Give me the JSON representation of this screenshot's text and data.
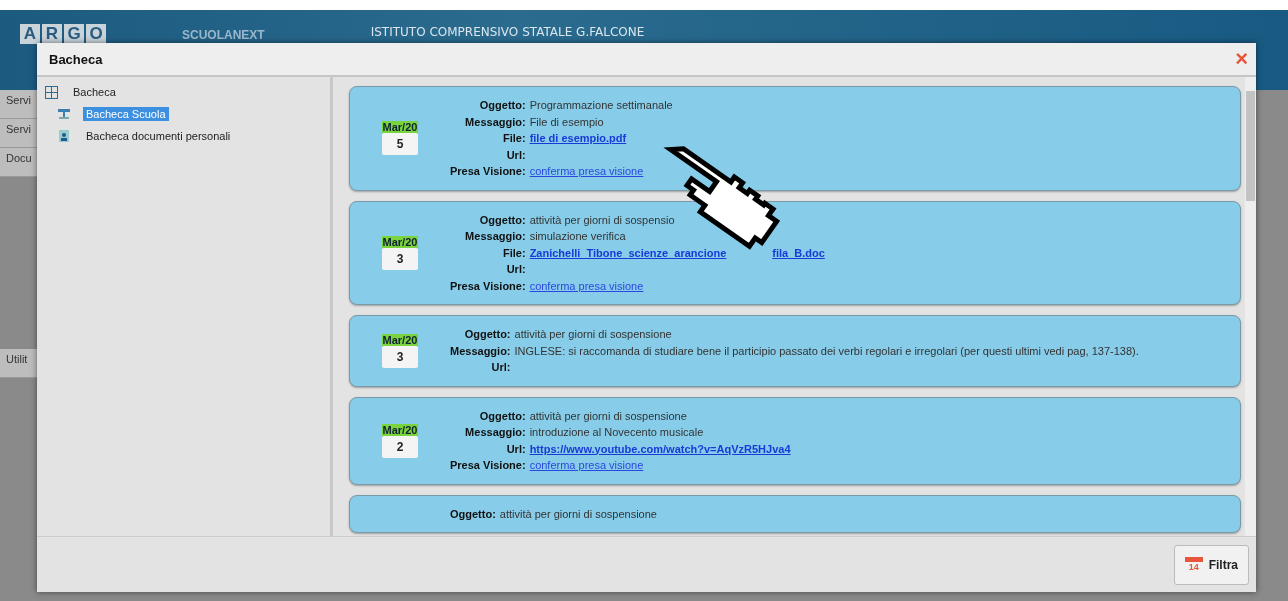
{
  "app_header": {
    "logo_letters": [
      "A",
      "R",
      "G",
      "O"
    ],
    "product": "SCUOLANEXT",
    "school": "ISTITUTO COMPRENSIVO STATALE G.FALCONE"
  },
  "background_menu": [
    "Servi",
    "Servi",
    "Docu",
    "Utilit"
  ],
  "dialog": {
    "title": "Bacheca",
    "close": "×"
  },
  "tree": {
    "label": "Bacheca",
    "expanded": true,
    "children": [
      {
        "label": "Bacheca Scuola",
        "kind": "school",
        "selected": true
      },
      {
        "label": "Bacheca documenti personali",
        "kind": "personal",
        "selected": false
      }
    ]
  },
  "cards": [
    {
      "month": "Mar/20",
      "day": "5",
      "fields": [
        {
          "label": "Oggetto:",
          "kind": "text",
          "value": "Programmazione settimanale"
        },
        {
          "label": "Messaggio:",
          "kind": "text",
          "value": "File di esempio"
        },
        {
          "label": "File:",
          "kind": "file",
          "value": "file di esempio.pdf"
        },
        {
          "label": "Url:",
          "kind": "text"
        },
        {
          "label": "Presa Visione:",
          "kind": "action",
          "value": "conferma presa visione"
        }
      ]
    },
    {
      "month": "Mar/20",
      "day": "3",
      "fields": [
        {
          "label": "Oggetto:",
          "kind": "text",
          "value": "attività per giorni di sospensio"
        },
        {
          "label": "Messaggio:",
          "kind": "text",
          "value": "simulazione verifica"
        },
        {
          "label": "File:",
          "kind": "file",
          "value": "Zanichelli_Tibone_scienze_arancione",
          "value_end": "fila_B.doc"
        },
        {
          "label": "Url:",
          "kind": "text"
        },
        {
          "label": "Presa Visione:",
          "kind": "action",
          "value": "conferma presa visione"
        }
      ]
    },
    {
      "month": "Mar/20",
      "day": "3",
      "fields": [
        {
          "label": "Oggetto:",
          "kind": "text",
          "value": "attività per giorni di sospensione"
        },
        {
          "label": "Messaggio:",
          "kind": "text",
          "value": "INGLESE: si raccomanda di studiare bene il participio passato dei verbi regolari e irregolari (per questi ultimi vedi pag, 137-138)."
        },
        {
          "label": "Url:",
          "kind": "text"
        }
      ]
    },
    {
      "month": "Mar/20",
      "day": "2",
      "fields": [
        {
          "label": "Oggetto:",
          "kind": "text",
          "value": "attività per giorni di sospensione"
        },
        {
          "label": "Messaggio:",
          "kind": "text",
          "value": "introduzione al Novecento musicale"
        },
        {
          "label": "Url:",
          "kind": "file",
          "value": "https://www.youtube.com/watch?v=AqVzR5HJva4"
        },
        {
          "label": "Presa Visione:",
          "kind": "action",
          "value": "conferma presa visione"
        }
      ]
    },
    {
      "fields": [
        {
          "label": "Oggetto:",
          "kind": "text",
          "value": "attività per giorni di sospensione"
        }
      ]
    }
  ],
  "filter_button": {
    "icon_text": "14",
    "label": "Filtra"
  }
}
